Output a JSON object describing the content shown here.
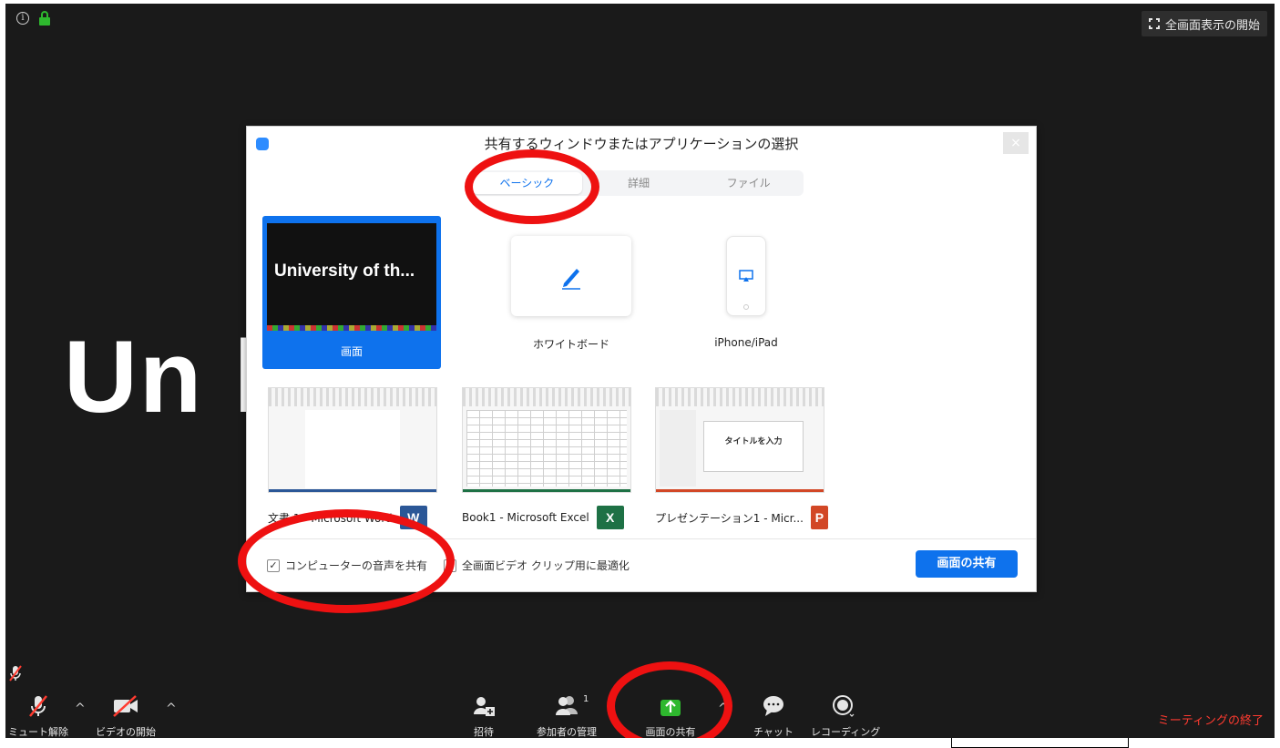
{
  "top_bar": {
    "fullscreen_label": "全画面表示の開始"
  },
  "shared_screen_text": "Un                                                h...",
  "dialog": {
    "title": "共有するウィンドウまたはアプリケーションの選択",
    "close_label": "×",
    "tabs": [
      {
        "label": "ベーシック",
        "active": true
      },
      {
        "label": "詳細",
        "active": false
      },
      {
        "label": "ファイル",
        "active": false
      }
    ],
    "tiles": {
      "screen": {
        "label": "画面",
        "thumb_text": "University of th..."
      },
      "whiteboard": {
        "label": "ホワイトボード"
      },
      "iphone": {
        "label": "iPhone/iPad"
      }
    },
    "windows": [
      {
        "label": "文書 1 - Microsoft Word",
        "badge": "W",
        "color": "#2b5797"
      },
      {
        "label": "Book1 - Microsoft Excel",
        "badge": "X",
        "color": "#1e7145"
      },
      {
        "label": "プレゼンテーション1 - Micr...",
        "badge": "P",
        "color": "#d24726",
        "slide_title": "タイトルを入力"
      }
    ],
    "footer": {
      "share_audio_label": "コンピューターの音声を共有",
      "share_audio_checked": true,
      "optimize_label": "全画面ビデオ クリップ用に最適化",
      "optimize_checked": false,
      "share_button": "画面の共有"
    }
  },
  "toolbar": {
    "unmute": "ミュート解除",
    "start_video": "ビデオの開始",
    "invite": "招待",
    "participants": "参加者の管理",
    "participants_count": "1",
    "share_screen": "画面の共有",
    "chat": "チャット",
    "recording": "レコーディング",
    "end_meeting": "ミーティングの終了"
  },
  "colors": {
    "accent": "#0e72ed",
    "share_green": "#2eb82e",
    "end_red": "#ff3b30",
    "annotation_red": "#ee1111"
  }
}
